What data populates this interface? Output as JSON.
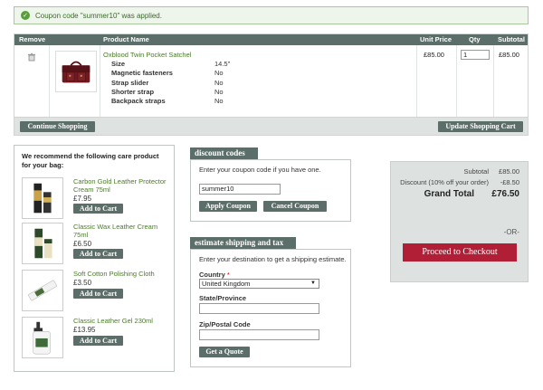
{
  "message": {
    "text": "Coupon code \"summer10\" was applied."
  },
  "cart": {
    "headers": {
      "remove": "Remove",
      "product": "Product Name",
      "unit_price": "Unit Price",
      "qty": "Qty",
      "subtotal": "Subtotal"
    },
    "item": {
      "name": "Oxblood Twin Pocket Satchel",
      "options": [
        {
          "label": "Size",
          "value": "14.5\""
        },
        {
          "label": "Magnetic fasteners",
          "value": "No"
        },
        {
          "label": "Strap slider",
          "value": "No"
        },
        {
          "label": "Shorter strap",
          "value": "No"
        },
        {
          "label": "Backpack straps",
          "value": "No"
        }
      ],
      "unit_price": "£85.00",
      "qty": "1",
      "subtotal": "£85.00"
    },
    "continue_label": "Continue Shopping",
    "update_label": "Update Shopping Cart"
  },
  "recommend": {
    "title": "We recommend the following care product for your bag:",
    "items": [
      {
        "name": "Carbon Gold Leather Protector Cream 75ml",
        "price": "£7.95",
        "add": "Add to Cart"
      },
      {
        "name": "Classic Wax Leather Cream 75ml",
        "price": "£6.50",
        "add": "Add to Cart"
      },
      {
        "name": "Soft Cotton Polishing Cloth",
        "price": "£3.50",
        "add": "Add to Cart"
      },
      {
        "name": "Classic Leather Gel 230ml",
        "price": "£13.95",
        "add": "Add to Cart"
      }
    ]
  },
  "discount": {
    "title": "discount codes",
    "prompt": "Enter your coupon code if you have one.",
    "value": "summer10",
    "apply_label": "Apply Coupon",
    "cancel_label": "Cancel Coupon"
  },
  "shipping": {
    "title": "estimate shipping and tax",
    "prompt": "Enter your destination to get a shipping estimate.",
    "country_label": "Country",
    "required_mark": "*",
    "country_value": "United Kingdom",
    "state_label": "State/Province",
    "zip_label": "Zip/Postal Code",
    "quote_label": "Get a Quote"
  },
  "totals": {
    "subtotal_label": "Subtotal",
    "subtotal_value": "£85.00",
    "discount_label": "Discount (10% off your order)",
    "discount_value": "-£8.50",
    "grand_label": "Grand Total",
    "grand_value": "£76.50",
    "or_label": "-OR-",
    "checkout_label": "Proceed to Checkout"
  },
  "colors": {
    "header": "#5c6e69",
    "link_green": "#4b7a2a",
    "checkout_red": "#b11f37",
    "totals_bg": "#dde2e1"
  }
}
